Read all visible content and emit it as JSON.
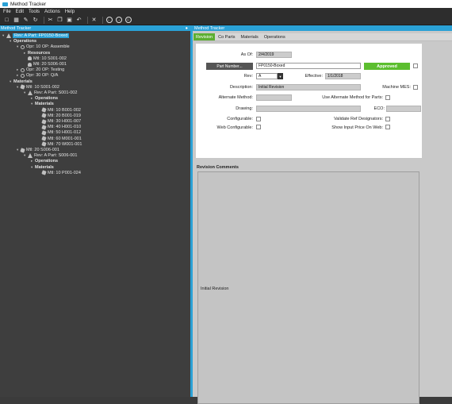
{
  "window": {
    "title": "Method Tracker"
  },
  "menu": [
    "File",
    "Edit",
    "Tools",
    "Actions",
    "Help"
  ],
  "toolbar": {
    "icons": [
      "new-icon",
      "save-icon",
      "edit-icon",
      "refresh-icon",
      "cut-icon",
      "copy-icon",
      "paste-icon",
      "undo-icon",
      "delete-icon",
      "back-icon",
      "forward-icon",
      "home-icon"
    ]
  },
  "left_panel": {
    "title": "Method Tracker",
    "pin": "⚓"
  },
  "tree": [
    {
      "label": "Rev: A Part: FP0150-Boxed",
      "indent": 0,
      "icon": "tri",
      "tog": "▾",
      "sel": true,
      "bold": false
    },
    {
      "label": "Operations",
      "indent": 1,
      "icon": "",
      "tog": "▾",
      "bold": true
    },
    {
      "label": "Opr: 10 OP: Assemble",
      "indent": 2,
      "icon": "gear",
      "tog": "▾"
    },
    {
      "label": "Resources",
      "indent": 3,
      "icon": "",
      "tog": "▸",
      "bold": true
    },
    {
      "label": "Mtl: 10 S001-002",
      "indent": 3,
      "icon": "person",
      "tog": ""
    },
    {
      "label": "Mtl: 20 S006-001",
      "indent": 3,
      "icon": "person",
      "tog": ""
    },
    {
      "label": "Opr: 20 OP: Testing",
      "indent": 2,
      "icon": "gear",
      "tog": "▸"
    },
    {
      "label": "Opr: 30 OP: Q/A",
      "indent": 2,
      "icon": "gear",
      "tog": "▸"
    },
    {
      "label": "Materials",
      "indent": 1,
      "icon": "",
      "tog": "▾",
      "bold": true
    },
    {
      "label": "Mtl: 10 S001-002",
      "indent": 2,
      "icon": "mtl",
      "tog": "▾"
    },
    {
      "label": "Rev: A Part: S001-002",
      "indent": 3,
      "icon": "tri",
      "tog": "▾"
    },
    {
      "label": "Operations",
      "indent": 4,
      "icon": "",
      "tog": "▸",
      "bold": true
    },
    {
      "label": "Materials",
      "indent": 4,
      "icon": "",
      "tog": "▾",
      "bold": true
    },
    {
      "label": "Mtl: 10 B001-002",
      "indent": 5,
      "icon": "mtl",
      "tog": ""
    },
    {
      "label": "Mtl: 20 B001-019",
      "indent": 5,
      "icon": "mtl",
      "tog": ""
    },
    {
      "label": "Mtl: 30 H001-007",
      "indent": 5,
      "icon": "mtl",
      "tog": ""
    },
    {
      "label": "Mtl: 40 H001-010",
      "indent": 5,
      "icon": "mtl",
      "tog": ""
    },
    {
      "label": "Mtl: 50 H001-012",
      "indent": 5,
      "icon": "mtl",
      "tog": ""
    },
    {
      "label": "Mtl: 60 M001-001",
      "indent": 5,
      "icon": "mtl",
      "tog": ""
    },
    {
      "label": "Mtl: 70 W001-001",
      "indent": 5,
      "icon": "mtl",
      "tog": ""
    },
    {
      "label": "Mtl: 20 S006-001",
      "indent": 2,
      "icon": "mtl",
      "tog": "▾"
    },
    {
      "label": "Rev: A Part: S006-001",
      "indent": 3,
      "icon": "tri",
      "tog": "▾"
    },
    {
      "label": "Operations",
      "indent": 4,
      "icon": "",
      "tog": "▸",
      "bold": true
    },
    {
      "label": "Materials",
      "indent": 4,
      "icon": "",
      "tog": "▾",
      "bold": true
    },
    {
      "label": "Mtl: 10 P001-024",
      "indent": 5,
      "icon": "mtl",
      "tog": ""
    }
  ],
  "right_panel": {
    "title": "Method Tracker"
  },
  "tabs": [
    {
      "label": "Revision",
      "active": true
    },
    {
      "label": "Co Parts",
      "active": false
    },
    {
      "label": "Materials",
      "active": false
    },
    {
      "label": "Operations",
      "active": false
    }
  ],
  "form": {
    "as_of_label": "As Of:",
    "as_of_value": "2/4/2019",
    "part_button": "Part Number...",
    "part_value": "FP0150-Boxed",
    "approved": "Approved",
    "rev_label": "Rev:",
    "rev_value": "A",
    "effective_label": "Effective:",
    "effective_value": "1/1/2018",
    "description_label": "Description:",
    "description_value": "Initial Revision",
    "machine_mes_label": "Machine MES:",
    "alternate_method_label": "Alternate Method:",
    "use_alt_method_label": "Use Alternate Method for Parts:",
    "drawing_label": "Drawing:",
    "eco_label": "ECO:",
    "configurable_label": "Configurable:",
    "validate_ref_label": "Validate Ref Designators:",
    "web_configurable_label": "Web Configurable:",
    "show_input_price_label": "Show Input Price On Web:"
  },
  "revision_comments": {
    "header": "Revision Comments",
    "text": "Initial Revision"
  }
}
